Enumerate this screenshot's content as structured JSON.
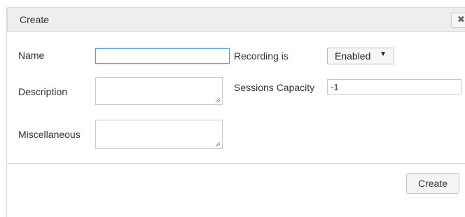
{
  "dialog": {
    "title": "Create",
    "close_icon": "close-icon",
    "close_glyph": "✖"
  },
  "form": {
    "name_label": "Name",
    "name_value": "",
    "description_label": "Description",
    "description_value": "",
    "misc_label": "Miscellaneous",
    "misc_value": "",
    "recording_label": "Recording is",
    "recording_selected": "Enabled",
    "sessions_label": "Sessions Capacity",
    "sessions_value": "-1"
  },
  "footer": {
    "create_label": "Create"
  },
  "colors": {
    "focus_border": "#5b9dd9",
    "header_bg": "#eeeeee"
  }
}
